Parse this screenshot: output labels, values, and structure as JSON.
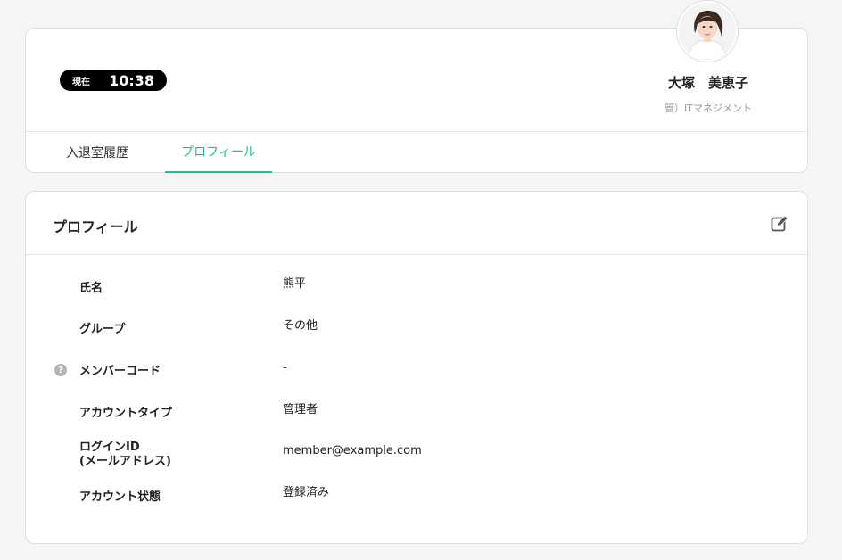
{
  "header": {
    "clock_label": "現在",
    "clock_time": "10:38",
    "user_name": "大塚　美恵子",
    "user_group": "管）ITマネジメント"
  },
  "tabs": [
    {
      "label": "入退室履歴",
      "active": false
    },
    {
      "label": "プロフィール",
      "active": true
    }
  ],
  "profile": {
    "title": "プロフィール",
    "fields": [
      {
        "label": "氏名",
        "value": "熊平"
      },
      {
        "label": "グループ",
        "value": "その他"
      },
      {
        "label": "メンバーコード",
        "value": "-",
        "help": "?"
      },
      {
        "label": "アカウントタイプ",
        "value": "管理者"
      },
      {
        "label_line1": "ログインID",
        "label_line2": "(メールアドレス)",
        "value": "member@example.com"
      },
      {
        "label": "アカウント状態",
        "value": "登録済み"
      }
    ]
  },
  "colors": {
    "accent": "#23c28c",
    "background": "#f5f5f5",
    "clock_bg": "#000000"
  },
  "icons": {
    "edit": "edit-icon",
    "help": "help-icon"
  }
}
